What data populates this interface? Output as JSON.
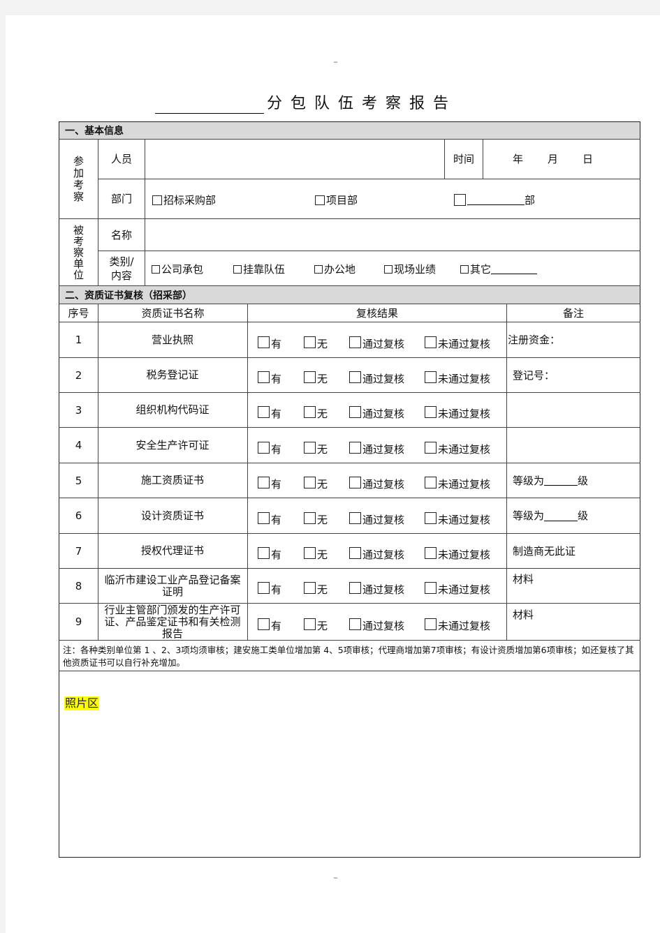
{
  "page_marks": {
    "top": "--",
    "bottom": "--"
  },
  "title": "分包队伍考察报告",
  "section1": {
    "header": "一、基本信息",
    "participants_group_label": [
      "参",
      "加",
      "考",
      "察"
    ],
    "personnel_label": "人员",
    "personnel_value": "",
    "time_label": "时间",
    "date": {
      "year": "年",
      "month": "月",
      "day": "日"
    },
    "department_label": "部门",
    "department_options": [
      {
        "label": "招标采购部",
        "checked": false
      },
      {
        "label": "项目部",
        "checked": false
      },
      {
        "label": "部",
        "checked": false,
        "blank": true
      }
    ],
    "inspected_group_label": [
      "被",
      "考",
      "察",
      "单",
      "位"
    ],
    "name_label": "名称",
    "name_value": "",
    "category_label": [
      "类别/",
      "内容"
    ],
    "category_options": [
      {
        "label": "公司承包",
        "checked": false
      },
      {
        "label": "挂靠队伍",
        "checked": false
      },
      {
        "label": "办公地",
        "checked": false
      },
      {
        "label": "现场业绩",
        "checked": false
      },
      {
        "label": "其它",
        "checked": false,
        "blank_after": true
      }
    ]
  },
  "section2": {
    "header": "二、资质证书复核（招采部）",
    "columns": [
      "序号",
      "资质证书名称",
      "复核结果",
      "备注"
    ],
    "result_options": [
      "有",
      "无",
      "通过复核",
      "未通过复核"
    ],
    "rows": [
      {
        "no": "1",
        "name": "营业执照",
        "remark": "注册资金："
      },
      {
        "no": "2",
        "name": "税务登记证",
        "remark": "登记号："
      },
      {
        "no": "3",
        "name": "组织机构代码证",
        "remark": ""
      },
      {
        "no": "4",
        "name": "安全生产许可证",
        "remark": ""
      },
      {
        "no": "5",
        "name": "施工资质证书",
        "remark": "等级为",
        "remark_suffix": "级"
      },
      {
        "no": "6",
        "name": "设计资质证书",
        "remark": "等级为",
        "remark_suffix": "级"
      },
      {
        "no": "7",
        "name": "授权代理证书",
        "remark": "制造商无此证"
      },
      {
        "no": "8",
        "name": "临沂市建设工业产品登记备案证明",
        "remark": "材料"
      },
      {
        "no": "9",
        "name": "行业主管部门颁发的生产许可证、产品鉴定证书和有关检测报告",
        "remark": "材料"
      }
    ],
    "note": "注：各种类别单位第 1 、2、3项均须审核；建安施工类单位增加第 4、5项审核；代理商增加第7项审核；有设计资质增加第6项审核；如还复核了其他资质证书可以自行补充增加。"
  },
  "photo_area": {
    "label": "照片区",
    "highlight_color": "#ffff00"
  }
}
